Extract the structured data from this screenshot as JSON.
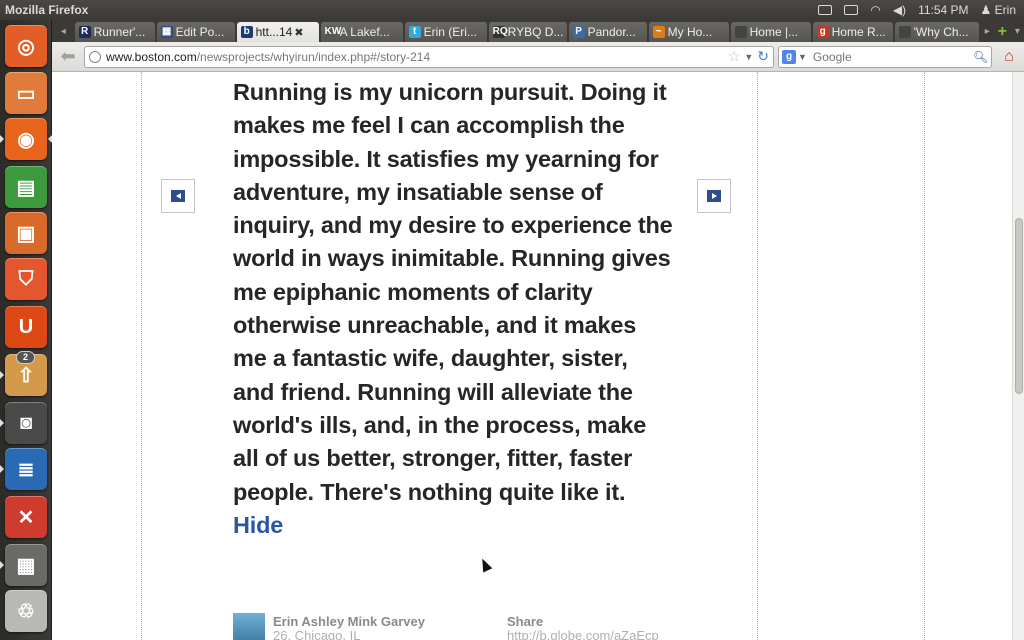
{
  "system": {
    "window_title": "Mozilla Firefox",
    "clock": "11:54 PM",
    "user": "Erin"
  },
  "launcher": {
    "items": [
      {
        "name": "dash",
        "color": "#e35d26"
      },
      {
        "name": "files",
        "color": "#e07b3c"
      },
      {
        "name": "firefox",
        "color": "#e8631c"
      },
      {
        "name": "spreadsheet",
        "color": "#3c9a3c"
      },
      {
        "name": "presentation",
        "color": "#d86a2a"
      },
      {
        "name": "shopping",
        "color": "#e4572e"
      },
      {
        "name": "ubuntu-one",
        "color": "#dd4814"
      },
      {
        "name": "updates",
        "color": "#d49a4b",
        "badge": "2"
      },
      {
        "name": "system-monitor",
        "color": "#4a4a4a"
      },
      {
        "name": "writer",
        "color": "#2a6ab5"
      },
      {
        "name": "settings",
        "color": "#cf3b2c"
      },
      {
        "name": "workspaces",
        "color": "#6a6a66"
      },
      {
        "name": "trash",
        "color": "#b8b8b4"
      }
    ]
  },
  "tabs": [
    {
      "icon": "R",
      "label": "Runner'...",
      "icon_color": "#1a2a5a"
    },
    {
      "icon": "▦",
      "label": "Edit Po...",
      "icon_color": "#2a4a8a"
    },
    {
      "icon": "b",
      "label": "htt...14",
      "icon_color": "#1a3a7a",
      "active": true
    },
    {
      "icon": "KW",
      "label": "A Lakef...",
      "icon_color": "#555"
    },
    {
      "icon": "t",
      "label": "Erin (Eri...",
      "icon_color": "#33aadd"
    },
    {
      "icon": "RQ",
      "label": "RYBQ D...",
      "icon_color": "#333"
    },
    {
      "icon": "P",
      "label": "Pandor...",
      "icon_color": "#3a6aa8"
    },
    {
      "icon": "~",
      "label": "My Ho...",
      "icon_color": "#e07b1a"
    },
    {
      "icon": "",
      "label": "Home |...",
      "icon_color": "#444"
    },
    {
      "icon": "g",
      "label": "Home R...",
      "icon_color": "#c0392b"
    },
    {
      "icon": "",
      "label": "'Why Ch...",
      "icon_color": "#444"
    }
  ],
  "navbar": {
    "url_host": "www.boston.com",
    "url_path": "/newsprojects/whyirun/index.php#/story-214",
    "search_placeholder": "Google"
  },
  "story": {
    "text": "Running is my unicorn pursuit. Doing it makes me feel I can accomplish the impossible. It satisfies my yearning for adventure, my insatiable sense of inquiry, and my desire to experience the world in ways inimitable. Running gives me epiphanic moments of clarity otherwise unreachable, and it makes me a fantastic wife, daughter, sister, and friend. Running will alleviate the world's ills, and, in the process, make all of us better, stronger, fitter, faster people. There's nothing quite like it.",
    "hide_label": "Hide"
  },
  "author": {
    "name": "Erin Ashley Mink Garvey",
    "location": "26, Chicago, IL"
  },
  "share": {
    "label": "Share",
    "link": "http://b.globe.com/aZaEcp"
  }
}
